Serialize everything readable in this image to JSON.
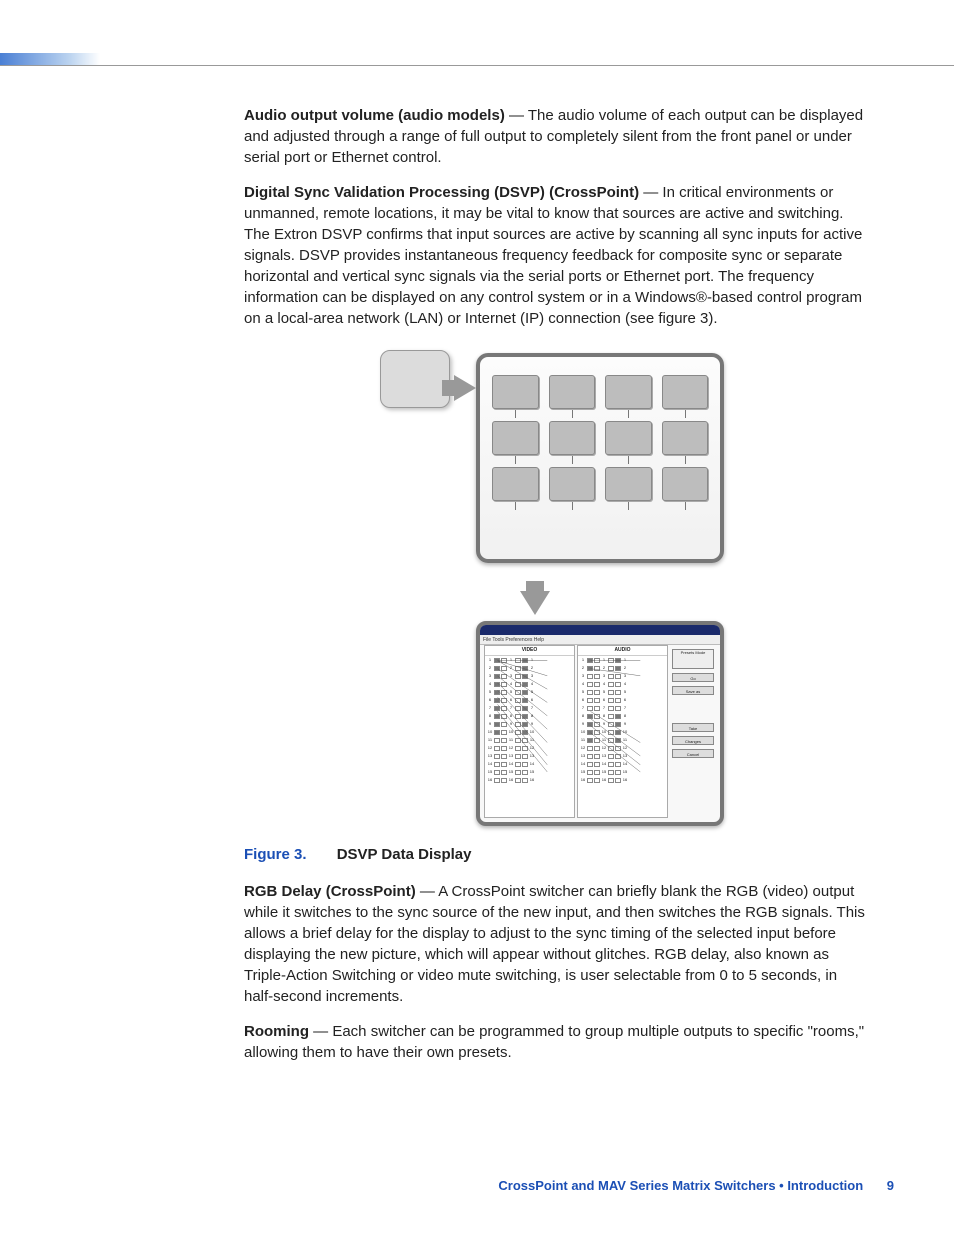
{
  "paragraphs": {
    "p1_strong": "Audio output volume (audio models)",
    "p1_body": " — The audio volume of each output can be displayed and adjusted through a range of full output to completely silent from the front panel or under serial port or Ethernet control.",
    "p2_strong": "Digital Sync Validation Processing (DSVP) (CrossPoint)",
    "p2_body": " — In critical environments or unmanned, remote locations, it may be vital to know that sources are active and switching. The Extron DSVP confirms that input sources are active by scanning all sync inputs for active signals. DSVP provides instantaneous frequency feedback for composite sync or separate horizontal and vertical sync signals via the serial ports or Ethernet port. The frequency information can be displayed on any control system or in a Windows®-based control program on a local-area network (LAN) or Internet (IP) connection (see figure 3).",
    "p3_strong": "RGB Delay (CrossPoint)",
    "p3_body": " — A CrossPoint switcher can briefly blank the RGB (video) output while it switches to the sync source of the new input, and then switches the RGB signals. This allows a brief delay for the display to adjust to the sync timing of the selected input before displaying the new picture, which will appear without glitches. RGB delay, also known as Triple-Action Switching or video mute switching, is user selectable from 0 to 5 seconds, in half-second increments.",
    "p4_strong": "Rooming",
    "p4_body": " — Each switcher can be programmed to group multiple outputs to specific \"rooms,\" allowing them to have their own presets."
  },
  "figure": {
    "number": "Figure 3.",
    "title": "DSVP Data Display",
    "menubar": "File  Tools  Preferences    Help",
    "col_video": "VIDEO",
    "col_audio": "AUDIO",
    "side_label1": "Presets Mode",
    "side_btn1": "Go",
    "side_btn2": "Save as",
    "side_spacer": "",
    "side_btn3": "Take",
    "side_btn4": "Changes",
    "side_btn5": "Cancel"
  },
  "footer": {
    "text": "CrossPoint and MAV Series Matrix Switchers • Introduction",
    "page": "9"
  },
  "rows": [
    "1",
    "2",
    "3",
    "4",
    "5",
    "6",
    "7",
    "8",
    "9",
    "10",
    "11",
    "12",
    "13",
    "14",
    "15",
    "16"
  ]
}
